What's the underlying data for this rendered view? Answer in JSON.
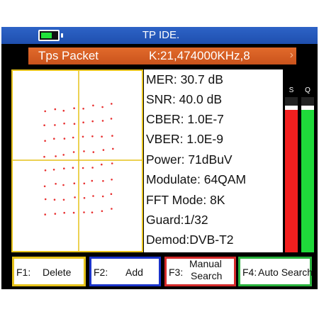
{
  "header": {
    "title": "TP IDE.",
    "battery_level": 0.7,
    "battery_color": "#21e33a"
  },
  "transponder": {
    "label": "Tps Packet",
    "frequency": "K:21,474000KHz,8",
    "arrow": "›"
  },
  "constellation": {
    "modulation_points": 64,
    "point_color": "#e83030",
    "axis_color": "#e6c21a"
  },
  "measurements": [
    {
      "text": "MER: 30.7 dB"
    },
    {
      "text": "SNR: 40.0 dB"
    },
    {
      "text": "CBER: 1.0E-7"
    },
    {
      "text": "VBER: 1.0E-9"
    },
    {
      "text": "Power: 71dBuV"
    },
    {
      "text": "Modulate: 64QAM"
    },
    {
      "text": "FFT Mode: 8K"
    },
    {
      "text": "Guard:1/32"
    },
    {
      "text": "Demod:DVB-T2"
    }
  ],
  "levels": {
    "strength": {
      "label": "S",
      "value": 0.92,
      "color": "#f21f1f"
    },
    "quality": {
      "label": "Q",
      "value": 0.92,
      "color": "#1fd93a"
    }
  },
  "function_keys": [
    {
      "key": "F1:",
      "label": "Delete",
      "color": "#e6c21a"
    },
    {
      "key": "F2:",
      "label": "Add",
      "color": "#1a33c9"
    },
    {
      "key": "F3:",
      "label_line1": "Manual",
      "label_line2": "Search",
      "color": "#d42a2a"
    },
    {
      "key": "F4:",
      "label": "Auto Search",
      "color": "#28b23c"
    }
  ]
}
